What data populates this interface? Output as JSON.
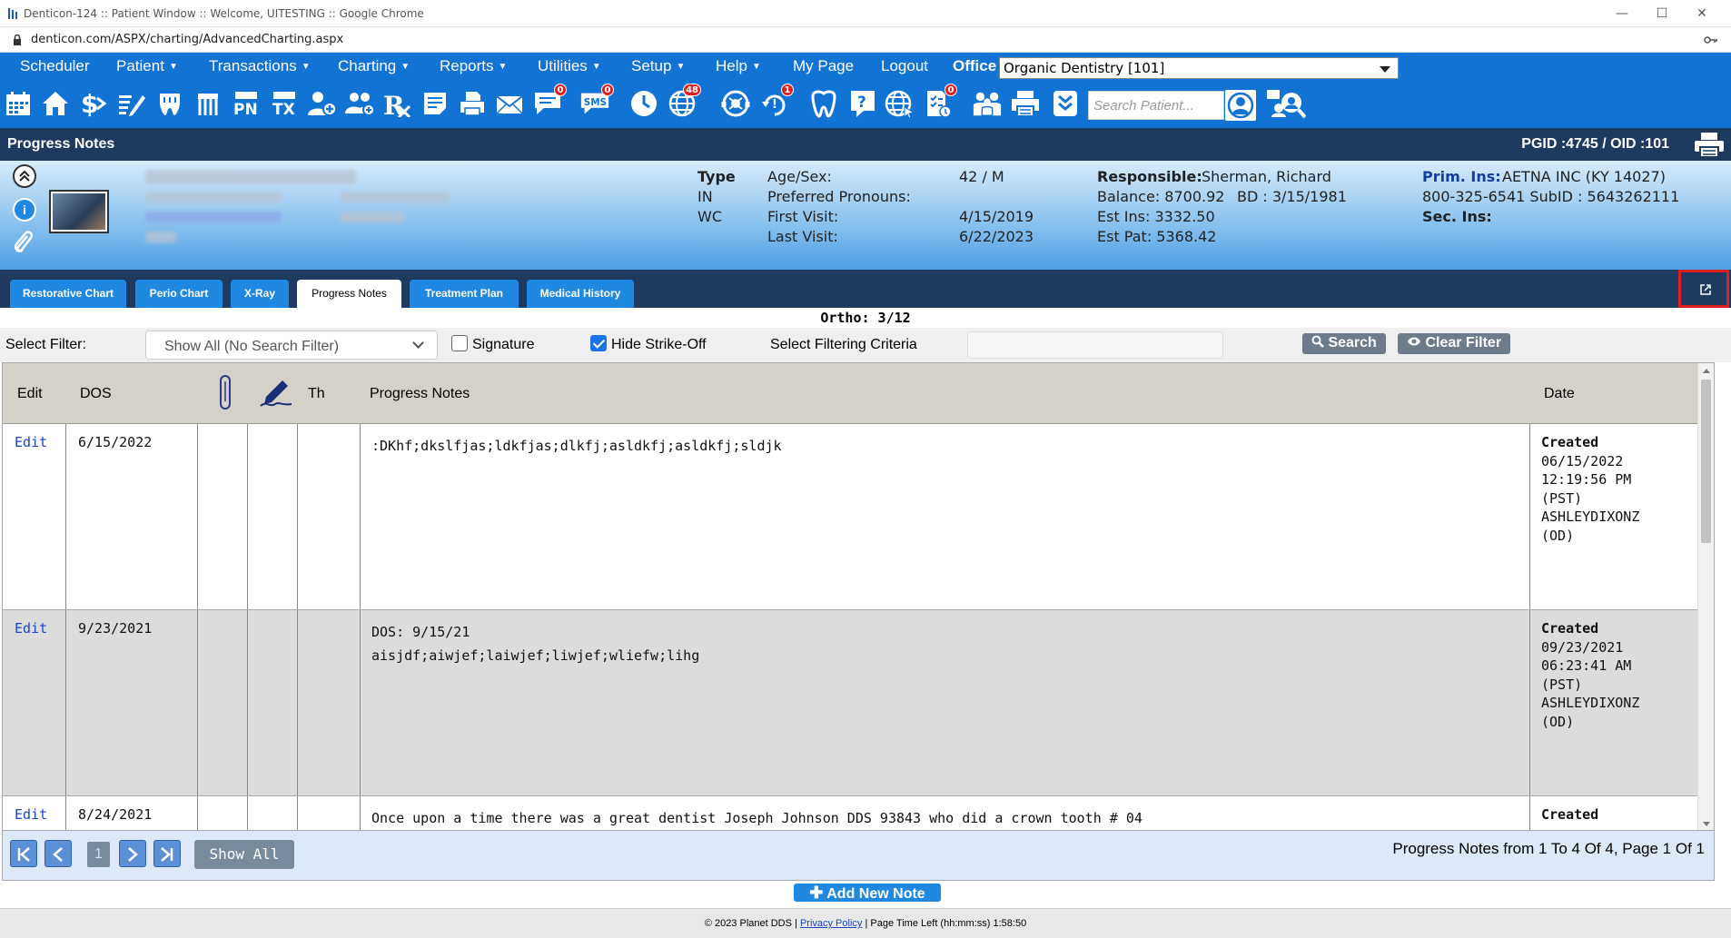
{
  "window": {
    "title": "Denticon-124 :: Patient Window :: Welcome, UITESTING :: Google Chrome",
    "url": "denticon.com/ASPX/charting/AdvancedCharting.aspx"
  },
  "menu": {
    "items": [
      "Scheduler",
      "Patient",
      "Transactions",
      "Charting",
      "Reports",
      "Utilities",
      "Setup",
      "Help",
      "My Page",
      "Logout"
    ],
    "office_label": "Office",
    "office_value": "Organic Dentistry [101]"
  },
  "toolbar": {
    "icons": [
      "calendar-icon",
      "home-icon",
      "dollar-icon",
      "edit-icon",
      "tooth-chart-icon",
      "perio-icon",
      "pn-icon",
      "tx-icon",
      "add-patient-icon",
      "family-icon",
      "rx-icon",
      "notes-icon",
      "print-icon",
      "email-icon",
      "message-icon",
      "sms-icon",
      "clock-icon",
      "globe-icon",
      "support-icon",
      "alert-icon",
      "tooth-icon",
      "help-icon",
      "web-icon",
      "forms-icon",
      "people-icon",
      "printer-icon",
      "download-icon"
    ],
    "badges": {
      "message": "0",
      "sms": "0",
      "globe": "48",
      "alert": "1",
      "forms": "0"
    },
    "search_placeholder": "Search Patient..."
  },
  "title_bar": {
    "title": "Progress Notes",
    "pgid": "PGID :4745  /  OID :101"
  },
  "patient": {
    "type_label": "Type",
    "type_values": [
      "IN",
      "WC"
    ],
    "age_sex_label": "Age/Sex:",
    "age_sex": "42 / M",
    "pronouns_label": "Preferred Pronouns:",
    "first_visit_label": "First Visit:",
    "first_visit": "4/15/2019",
    "last_visit_label": "Last Visit:",
    "last_visit": "6/22/2023",
    "responsible_label": "Responsible:",
    "responsible": "Sherman, Richard",
    "balance": "Balance: 8700.92",
    "bd": "BD : 3/15/1981",
    "est_ins": "Est Ins:  3332.50",
    "est_pat": "Est Pat: 5368.42",
    "prim_ins_label": "Prim. Ins:",
    "prim_ins": "AETNA INC (KY 14027)",
    "prim_ins_phone": "800-325-6541 SubID : 5643262111",
    "sec_ins_label": "Sec. Ins:"
  },
  "tabs": [
    "Restorative Chart",
    "Perio Chart",
    "X-Ray",
    "Progress Notes",
    "Treatment Plan",
    "Medical History"
  ],
  "ortho": "Ortho: 3/12",
  "filter": {
    "select_label": "Select Filter:",
    "select_value": "Show All (No Search Filter)",
    "signature_label": "Signature",
    "hide_strike_label": "Hide Strike-Off",
    "criteria_label": "Select Filtering Criteria",
    "search_button": "Search",
    "clear_button": "Clear Filter"
  },
  "table": {
    "headers": {
      "edit": "Edit",
      "dos": "DOS",
      "th": "Th",
      "notes": "Progress Notes",
      "date": "Date"
    },
    "rows": [
      {
        "edit": "Edit",
        "dos": "6/15/2022",
        "note_lines": [
          ":DKhf;dkslfjas;ldkfjas;dlkfj;asldkfj;asldkfj;sldjk"
        ],
        "created": "Created",
        "date_lines": [
          "06/15/2022",
          "12:19:56 PM",
          "(PST)",
          "ASHLEYDIXONZ",
          "(OD)"
        ]
      },
      {
        "edit": "Edit",
        "dos": "9/23/2021",
        "note_lines": [
          "DOS: 9/15/21",
          "aisjdf;aiwjef;laiwjef;liwjef;wliefw;lihg"
        ],
        "created": "Created",
        "date_lines": [
          "09/23/2021",
          "06:23:41 AM",
          "(PST)",
          "ASHLEYDIXONZ",
          "(OD)"
        ]
      },
      {
        "edit": "Edit",
        "dos": "8/24/2021",
        "note_lines": [
          "Once upon a time there was a great dentist Joseph Johnson DDS 93843 who did a crown tooth # 04"
        ],
        "created": "Created",
        "date_lines": []
      }
    ]
  },
  "pager": {
    "page": "1",
    "show_all": "Show All",
    "info": "Progress Notes from 1 To 4 Of 4, Page 1 Of 1"
  },
  "add_note": "Add New Note",
  "footer": {
    "copyright": "© 2023 Planet DDS |",
    "privacy": "Privacy Policy",
    "time_left": "| Page Time Left (hh:mm:ss) 1:58:50"
  }
}
